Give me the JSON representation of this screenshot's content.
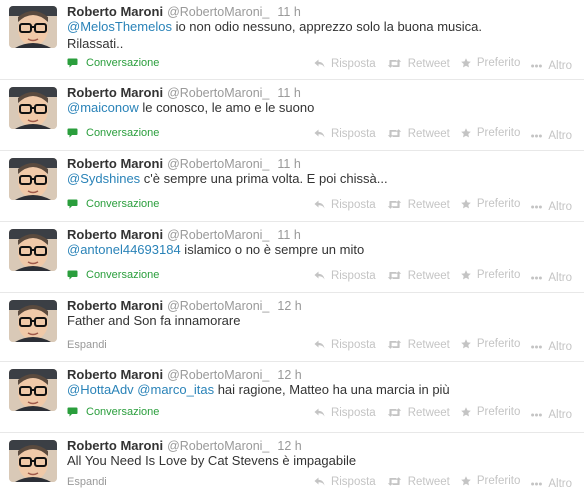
{
  "colors": {
    "mention": "#2a83b8",
    "conversation": "#2a9e3c",
    "muted": "#999999",
    "actions": "#c4c4c4"
  },
  "author": {
    "name": "Roberto Maroni",
    "handle": "@RobertoMaroni_"
  },
  "labels": {
    "conversation": "Conversazione",
    "expand": "Espandi",
    "reply": "Risposta",
    "retweet": "Retweet",
    "favorite": "Preferito",
    "more": "Altro"
  },
  "icons": {
    "conversation": "speech-bubble-icon",
    "reply": "reply-arrow-icon",
    "retweet": "retweet-icon",
    "favorite": "star-icon",
    "more": "more-dots-icon"
  },
  "tweets": [
    {
      "time": "11 h",
      "mention": "@MelosThemelos",
      "text": " io non odio nessuno, apprezzo solo la buona musica.",
      "text2": "Rilassati..",
      "footer": "conversation"
    },
    {
      "time": "11 h",
      "mention": "@maiconow",
      "text": " le conosco, le amo e le suono",
      "footer": "conversation"
    },
    {
      "time": "11 h",
      "mention": "@Sydshines",
      "text": " c'è sempre una prima volta. E poi chissà...",
      "footer": "conversation"
    },
    {
      "time": "11 h",
      "mention": "@antonel44693184",
      "text": " islamico o no è sempre un mito",
      "footer": "conversation"
    },
    {
      "time": "12 h",
      "mention": "",
      "text": "Father and Son fa innamorare",
      "footer": "expand"
    },
    {
      "time": "12 h",
      "mention": "@HottaAdv",
      "mention2": "@marco_itas",
      "text": " hai ragione, Matteo ha una marcia in più",
      "footer": "conversation"
    },
    {
      "time": "12 h",
      "mention": "",
      "text": "All You Need Is Love by Cat Stevens è impagabile",
      "footer": "expand"
    }
  ]
}
